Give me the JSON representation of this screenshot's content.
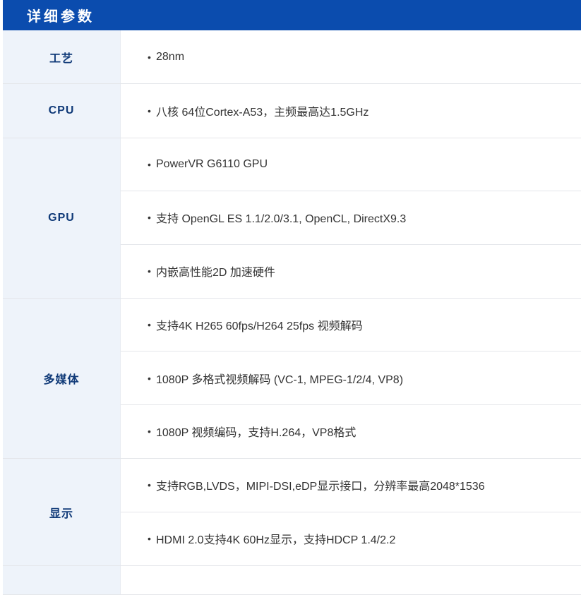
{
  "theme": {
    "accent": "#0b4cae",
    "label_bg": "#eef3fa",
    "label_text": "#103a78",
    "body_text": "#333333"
  },
  "header": {
    "title": "详细参数"
  },
  "specs": [
    {
      "label": "工艺",
      "items": [
        "28nm"
      ]
    },
    {
      "label": "CPU",
      "items": [
        "八核 64位Cortex-A53，主频最高达1.5GHz"
      ]
    },
    {
      "label": "GPU",
      "items": [
        "PowerVR G6110 GPU",
        "支持 OpenGL ES 1.1/2.0/3.1, OpenCL, DirectX9.3",
        "内嵌高性能2D 加速硬件"
      ]
    },
    {
      "label": "多媒体",
      "items": [
        "支持4K H265 60fps/H264 25fps 视频解码",
        "1080P 多格式视频解码 (VC-1, MPEG-1/2/4, VP8)",
        "1080P 视频编码，支持H.264，VP8格式"
      ]
    },
    {
      "label": "显示",
      "items": [
        "支持RGB,LVDS，MIPI-DSI,eDP显示接口，分辨率最高2048*1536",
        "HDMI 2.0支持4K 60Hz显示，支持HDCP 1.4/2.2"
      ]
    }
  ]
}
